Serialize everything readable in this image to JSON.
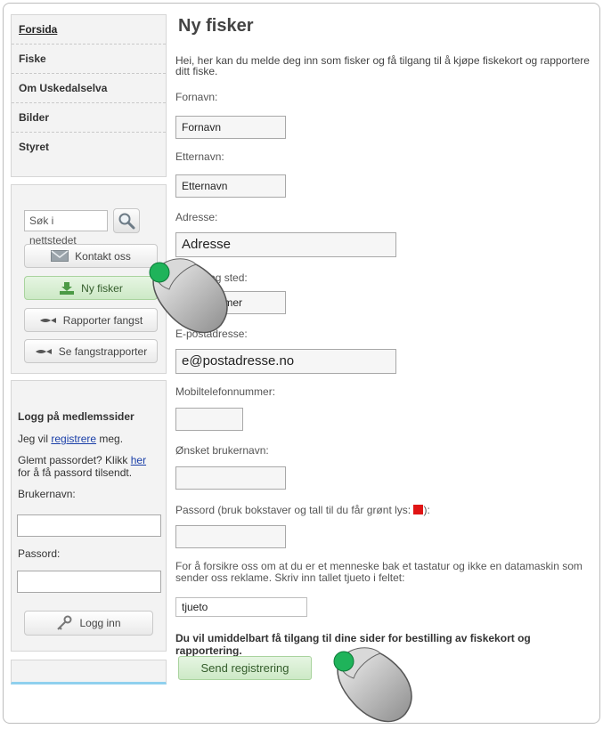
{
  "sidebar": {
    "nav": [
      "Forsida",
      "Fiske",
      "Om Uskedalselva",
      "Bilder",
      "Styret"
    ],
    "search_placeholder": "Søk i nettstedet",
    "buttons": {
      "kontakt": "Kontakt oss",
      "ny_fisker": "Ny fisker",
      "rapporter": "Rapporter fangst",
      "se": "Se fangstrapporter"
    }
  },
  "login": {
    "title": "Logg på medlemssider",
    "register_pre": "Jeg vil ",
    "register_link": "registrere",
    "register_post": " meg.",
    "forgot_pre": "Glemt passordet? Klikk ",
    "forgot_link": "her",
    "forgot_post": " for å få passord tilsendt.",
    "username_label": "Brukernavn:",
    "password_label": "Passord:",
    "button": "Logg inn"
  },
  "form": {
    "title": "Ny fisker",
    "intro": "Hei, her kan du melde deg inn som fisker og få tilgang til å kjøpe fiskekort og rapportere ditt fiske.",
    "fornavn_label": "Fornavn:",
    "fornavn_value": "Fornavn",
    "etternavn_label": "Etternavn:",
    "etternavn_value": "Etternavn",
    "adresse_label": "Adresse:",
    "adresse_value": "Adresse",
    "postnr_label": "Postnr og sted:",
    "postnr_value": "Postnummer",
    "epost_label": "E-postadresse:",
    "epost_value": "e@postadresse.no",
    "mobil_label": "Mobiltelefonnummer:",
    "mobil_value": "",
    "brukernavn_label": "Ønsket brukernavn:",
    "brukernavn_value": "",
    "passord_label_pre": "Passord (bruk bokstaver og tall til du får grønt lys: ",
    "passord_label_post": "):",
    "passord_value": "",
    "captcha_text": "For å forsikre oss om at du er et menneske bak et tastatur og ikke en datamaskin som sender oss reklame. Skriv inn tallet tjueto i feltet:",
    "captcha_value": "tjueto",
    "note": "Du vil umiddelbart få tilgang til dine sider for bestilling av fiskekort og rapportering.",
    "submit": "Send registrering"
  },
  "colors": {
    "accent_green": "#cde9c6",
    "status_red": "#e01515",
    "mouse_button": "#1fb35a"
  },
  "icons": [
    "search-icon",
    "envelope-icon",
    "download-icon",
    "fish-icon",
    "key-icon",
    "mouse-cursor-icon"
  ]
}
